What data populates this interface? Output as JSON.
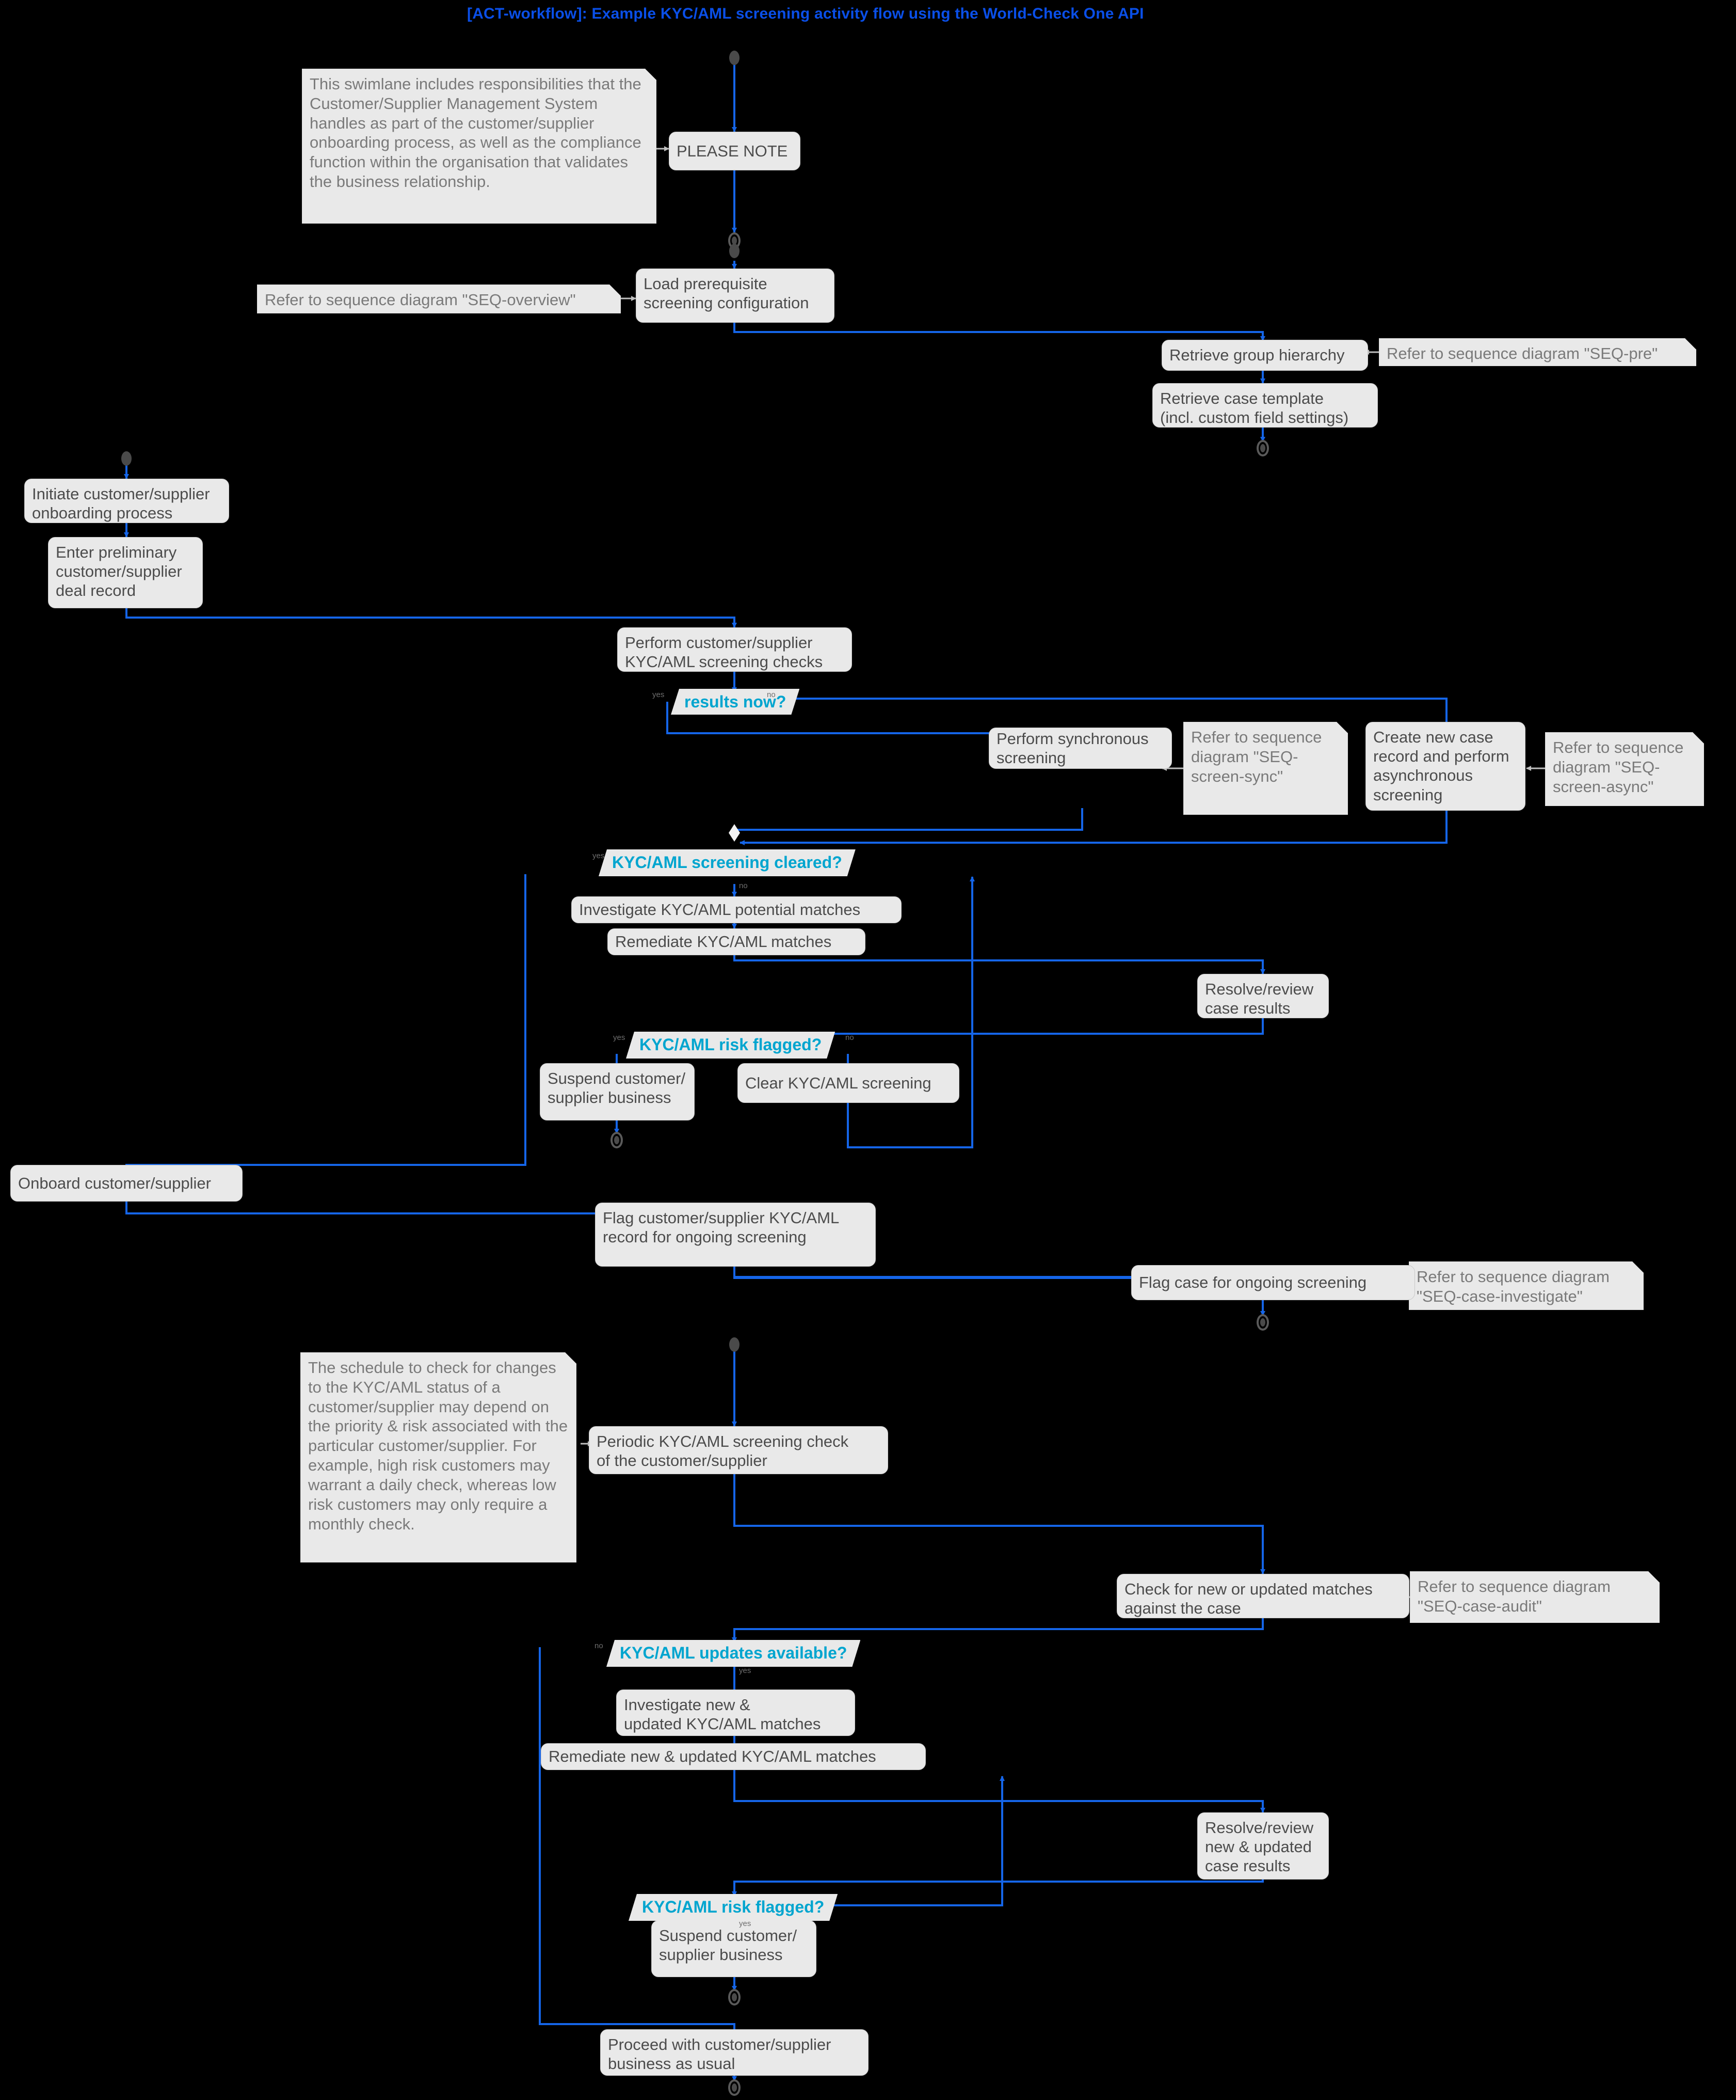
{
  "diagram": {
    "title": "[ACT-workflow]: Example KYC/AML screening activity flow using the World-Check One API",
    "type": "uml-activity-diagram",
    "colors": {
      "background": "#000000",
      "title": "#0A4FE8",
      "connector": "#1565E8",
      "activity_fill": "#E9E9E9",
      "activity_text": "#4C4C4C",
      "note_text": "#7A7A7A",
      "decision_text": "#00A5CF",
      "edge_label": "#6E6E6E",
      "node_marker": "#4A4A4A"
    }
  },
  "notes": {
    "swimlane_note": "This swimlane includes responsibilities that the Customer/Supplier Management System handles as part of the customer/supplier onboarding process, as well as the compliance function within the organisation that validates the business relationship.",
    "seq_overview": "Refer to sequence diagram \"SEQ-overview\"",
    "seq_pre": "Refer to sequence diagram \"SEQ-pre\"",
    "seq_screen_sync": "Refer to sequence diagram \"SEQ-screen-sync\"",
    "seq_screen_async": "Refer to sequence diagram \"SEQ-screen-async\"",
    "seq_case_investigate": "Refer to sequence diagram \"SEQ-case-investigate\"",
    "seq_case_audit": "Refer to sequence diagram \"SEQ-case-audit\"",
    "schedule_note": "The schedule to check for changes to the KYC/AML status of a customer/supplier may depend on the priority & risk associated with the particular customer/supplier. For example, high risk customers may warrant a daily check, whereas low risk customers may only require a monthly check."
  },
  "activities": {
    "please_note": "PLEASE NOTE",
    "load_prereq": "Load prerequisite\nscreening configuration",
    "retrieve_group": "Retrieve group hierarchy",
    "retrieve_template": "Retrieve case template\n(incl. custom field settings)",
    "initiate_onboarding": "Initiate customer/supplier\nonboarding process",
    "enter_prelim": "Enter preliminary\ncustomer/supplier\ndeal record",
    "perform_checks": "Perform customer/supplier\nKYC/AML screening checks",
    "perform_sync": "Perform synchronous\nscreening",
    "create_case_async": "Create new case\nrecord and perform\nasynchronous\nscreening",
    "investigate_matches": "Investigate KYC/AML potential matches",
    "remediate_matches": "Remediate KYC/AML matches",
    "resolve_review": "Resolve/review\ncase results",
    "suspend_business_1": "Suspend customer/\nsupplier business",
    "clear_screening": "Clear KYC/AML screening",
    "onboard": "Onboard customer/supplier",
    "flag_record": "Flag customer/supplier KYC/AML\nrecord for ongoing screening",
    "flag_case": "Flag case for ongoing screening",
    "periodic_check": "Periodic KYC/AML screening check\nof the customer/supplier",
    "check_new_matches": "Check for new or updated matches\nagainst the case",
    "investigate_new": "Investigate new &\nupdated KYC/AML matches",
    "remediate_new": "Remediate new & updated KYC/AML matches",
    "resolve_review_new": "Resolve/review\nnew & updated\ncase results",
    "suspend_business_2": "Suspend customer/\nsupplier business",
    "proceed_usual": "Proceed with customer/supplier\nbusiness as usual"
  },
  "decisions": {
    "results_now": "results now?",
    "screening_cleared": "KYC/AML screening cleared?",
    "risk_flagged_1": "KYC/AML risk flagged?",
    "updates_available": "KYC/AML updates available?",
    "risk_flagged_2": "KYC/AML risk flagged?"
  },
  "edge_labels": {
    "yes": "yes",
    "no": "no"
  }
}
